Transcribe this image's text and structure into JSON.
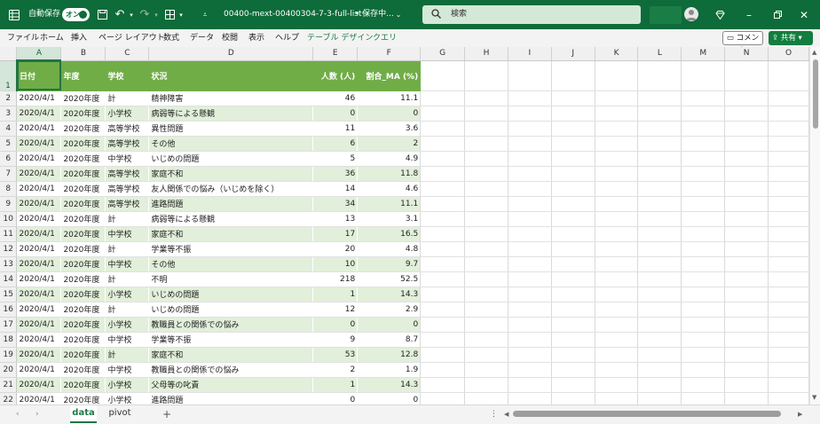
{
  "titlebar": {
    "autosave_label": "自動保存",
    "autosave_state": "オン",
    "filename": "00400-mext-00400304-7-3-full-list···",
    "save_status": "• 保存中...",
    "search_placeholder": "検索"
  },
  "menu": [
    "ファイル",
    "ホーム",
    "挿入",
    "ページ レイアウト",
    "数式",
    "データ",
    "校閲",
    "表示",
    "ヘルプ",
    "テーブル デザイン",
    "クエリ"
  ],
  "ribbon_buttons": {
    "comment": "コメント",
    "share": "共有"
  },
  "columns": [
    "A",
    "B",
    "C",
    "D",
    "E",
    "F",
    "G",
    "H",
    "I",
    "J",
    "K",
    "L",
    "M",
    "N",
    "O"
  ],
  "table": {
    "headers": [
      "日付",
      "年度",
      "学校",
      "状況",
      "人数 (人)",
      "割合_MA (%)"
    ],
    "rows": [
      [
        "2020/4/1",
        "2020年度",
        "計",
        "精神障害",
        "46",
        "11.1"
      ],
      [
        "2020/4/1",
        "2020年度",
        "小学校",
        "病弱等による懸観",
        "0",
        "0"
      ],
      [
        "2020/4/1",
        "2020年度",
        "高等学校",
        "異性問題",
        "11",
        "3.6"
      ],
      [
        "2020/4/1",
        "2020年度",
        "高等学校",
        "その他",
        "6",
        "2"
      ],
      [
        "2020/4/1",
        "2020年度",
        "中学校",
        "いじめの問題",
        "5",
        "4.9"
      ],
      [
        "2020/4/1",
        "2020年度",
        "高等学校",
        "家庭不和",
        "36",
        "11.8"
      ],
      [
        "2020/4/1",
        "2020年度",
        "高等学校",
        "友人関係での悩み（いじめを除く）",
        "14",
        "4.6"
      ],
      [
        "2020/4/1",
        "2020年度",
        "高等学校",
        "進路問題",
        "34",
        "11.1"
      ],
      [
        "2020/4/1",
        "2020年度",
        "計",
        "病弱等による懸観",
        "13",
        "3.1"
      ],
      [
        "2020/4/1",
        "2020年度",
        "中学校",
        "家庭不和",
        "17",
        "16.5"
      ],
      [
        "2020/4/1",
        "2020年度",
        "計",
        "学業等不振",
        "20",
        "4.8"
      ],
      [
        "2020/4/1",
        "2020年度",
        "中学校",
        "その他",
        "10",
        "9.7"
      ],
      [
        "2020/4/1",
        "2020年度",
        "計",
        "不明",
        "218",
        "52.5"
      ],
      [
        "2020/4/1",
        "2020年度",
        "小学校",
        "いじめの問題",
        "1",
        "14.3"
      ],
      [
        "2020/4/1",
        "2020年度",
        "計",
        "いじめの問題",
        "12",
        "2.9"
      ],
      [
        "2020/4/1",
        "2020年度",
        "小学校",
        "教職員との関係での悩み",
        "0",
        "0"
      ],
      [
        "2020/4/1",
        "2020年度",
        "中学校",
        "学業等不振",
        "9",
        "8.7"
      ],
      [
        "2020/4/1",
        "2020年度",
        "計",
        "家庭不和",
        "53",
        "12.8"
      ],
      [
        "2020/4/1",
        "2020年度",
        "中学校",
        "教職員との関係での悩み",
        "2",
        "1.9"
      ],
      [
        "2020/4/1",
        "2020年度",
        "小学校",
        "父母等の叱責",
        "1",
        "14.3"
      ],
      [
        "2020/4/1",
        "2020年度",
        "小学校",
        "進路問題",
        "0",
        "0"
      ]
    ]
  },
  "sheets": [
    "data",
    "pivot"
  ],
  "add_sheet": "+",
  "colors": {
    "title_bg": "#0e6b3a",
    "table_header": "#70ad47",
    "band": "#e2efda",
    "accent": "#217346"
  }
}
